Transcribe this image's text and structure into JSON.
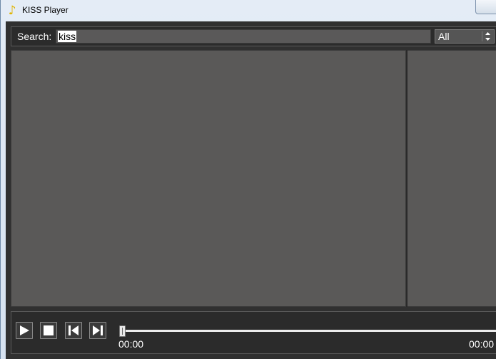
{
  "window": {
    "title": "KISS Player",
    "icon": "music-note-icon"
  },
  "search": {
    "label": "Search:",
    "value": "kiss",
    "filter_selected": "All"
  },
  "player": {
    "elapsed": "00:00",
    "total": "00:00",
    "progress": 0,
    "buttons": [
      "play-icon",
      "stop-icon",
      "previous-icon",
      "next-icon"
    ]
  },
  "colors": {
    "panel": "#5a5958",
    "background": "#303030",
    "text": "#ffffff"
  }
}
